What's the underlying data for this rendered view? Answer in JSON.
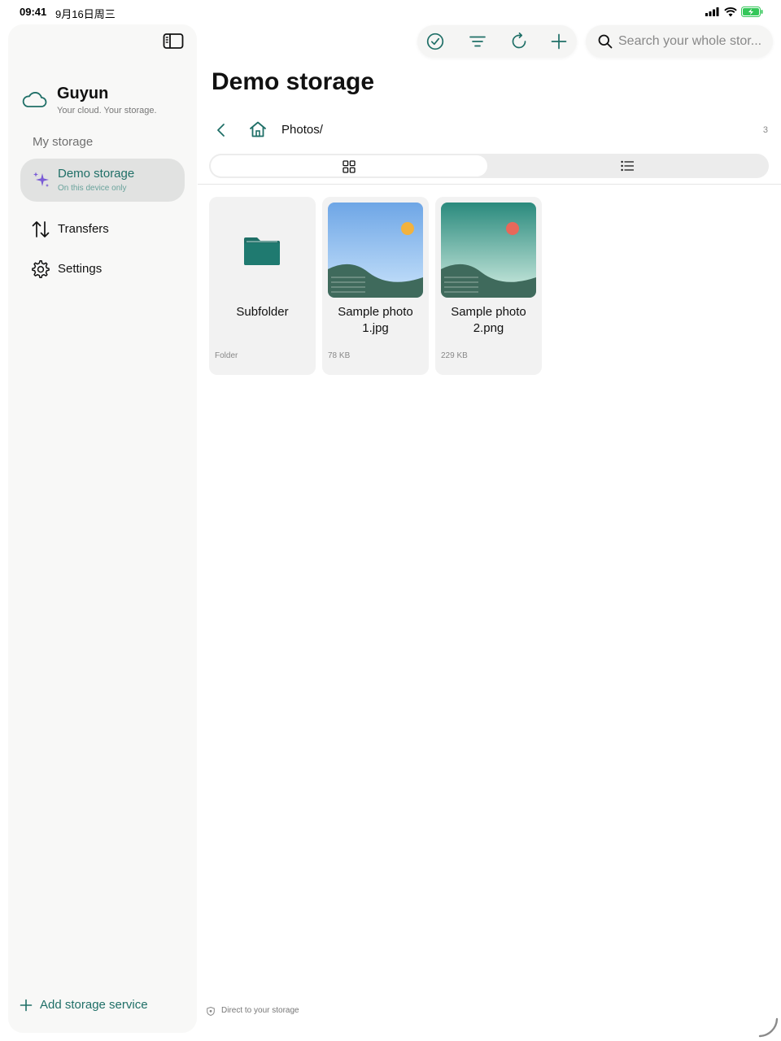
{
  "status_bar": {
    "time": "09:41",
    "date": "9月16日周三"
  },
  "sidebar": {
    "brand_name": "Guyun",
    "brand_tagline": "Your cloud. Your storage.",
    "section_title": "My storage",
    "active_item": {
      "label": "Demo storage",
      "sub": "On this device only"
    },
    "items": [
      {
        "label": "Transfers",
        "icon": "transfers-icon"
      },
      {
        "label": "Settings",
        "icon": "gear-icon"
      }
    ],
    "add_storage_label": "Add storage service"
  },
  "toolbar": {
    "buttons": [
      "select-icon",
      "sort-icon",
      "refresh-icon",
      "plus-icon"
    ],
    "search_placeholder": "Search your whole stor..."
  },
  "main": {
    "title": "Demo storage",
    "path": "Photos/",
    "count": "3",
    "view_mode": "grid",
    "items": [
      {
        "name": "Subfolder",
        "meta": "Folder",
        "kind": "folder"
      },
      {
        "name": "Sample photo 1.jpg",
        "meta": "78 KB",
        "kind": "image"
      },
      {
        "name": "Sample photo 2.png",
        "meta": "229 KB",
        "kind": "image"
      }
    ],
    "footer_note": "Direct to your storage"
  },
  "colors": {
    "accent": "#1f6f67",
    "sparkle": "#7b5cd6",
    "folder": "#1f6f67",
    "photo1_sky": "#8fbef0",
    "photo1_sun": "#f2b23e",
    "photo2_sky": "#2f8a7f",
    "photo2_sun": "#e8685a",
    "hill": "#3f6a5c"
  }
}
